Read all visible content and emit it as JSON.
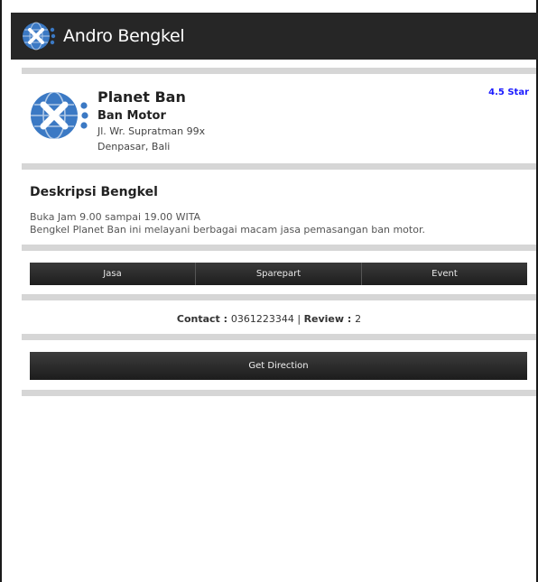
{
  "app": {
    "title": "Andro Bengkel",
    "icon": "wrench-screwdriver-globe-icon"
  },
  "shop": {
    "name": "Planet Ban",
    "category": "Ban Motor",
    "address_line1": "Jl. Wr. Supratman 99x",
    "address_line2": "Denpasar, Bali",
    "rating": "4.5 Star",
    "logo": "wrench-screwdriver-globe-icon"
  },
  "description": {
    "title": "Deskripsi Bengkel",
    "line1": "Buka Jam 9.00 sampai 19.00 WITA",
    "line2": "Bengkel Planet Ban ini melayani berbagai macam jasa pemasangan ban motor."
  },
  "tabs": [
    {
      "label": "Jasa"
    },
    {
      "label": "Sparepart"
    },
    {
      "label": "Event"
    }
  ],
  "contact": {
    "contact_label": "Contact : ",
    "contact_value": "0361223344",
    "separator": " | ",
    "review_label": "Review : ",
    "review_value": "2"
  },
  "direction_button": "Get Direction",
  "colors": {
    "appbar": "#262626",
    "logo_blue": "#3b79c4",
    "rating": "#1a1aff",
    "divider": "#d6d6d6"
  }
}
